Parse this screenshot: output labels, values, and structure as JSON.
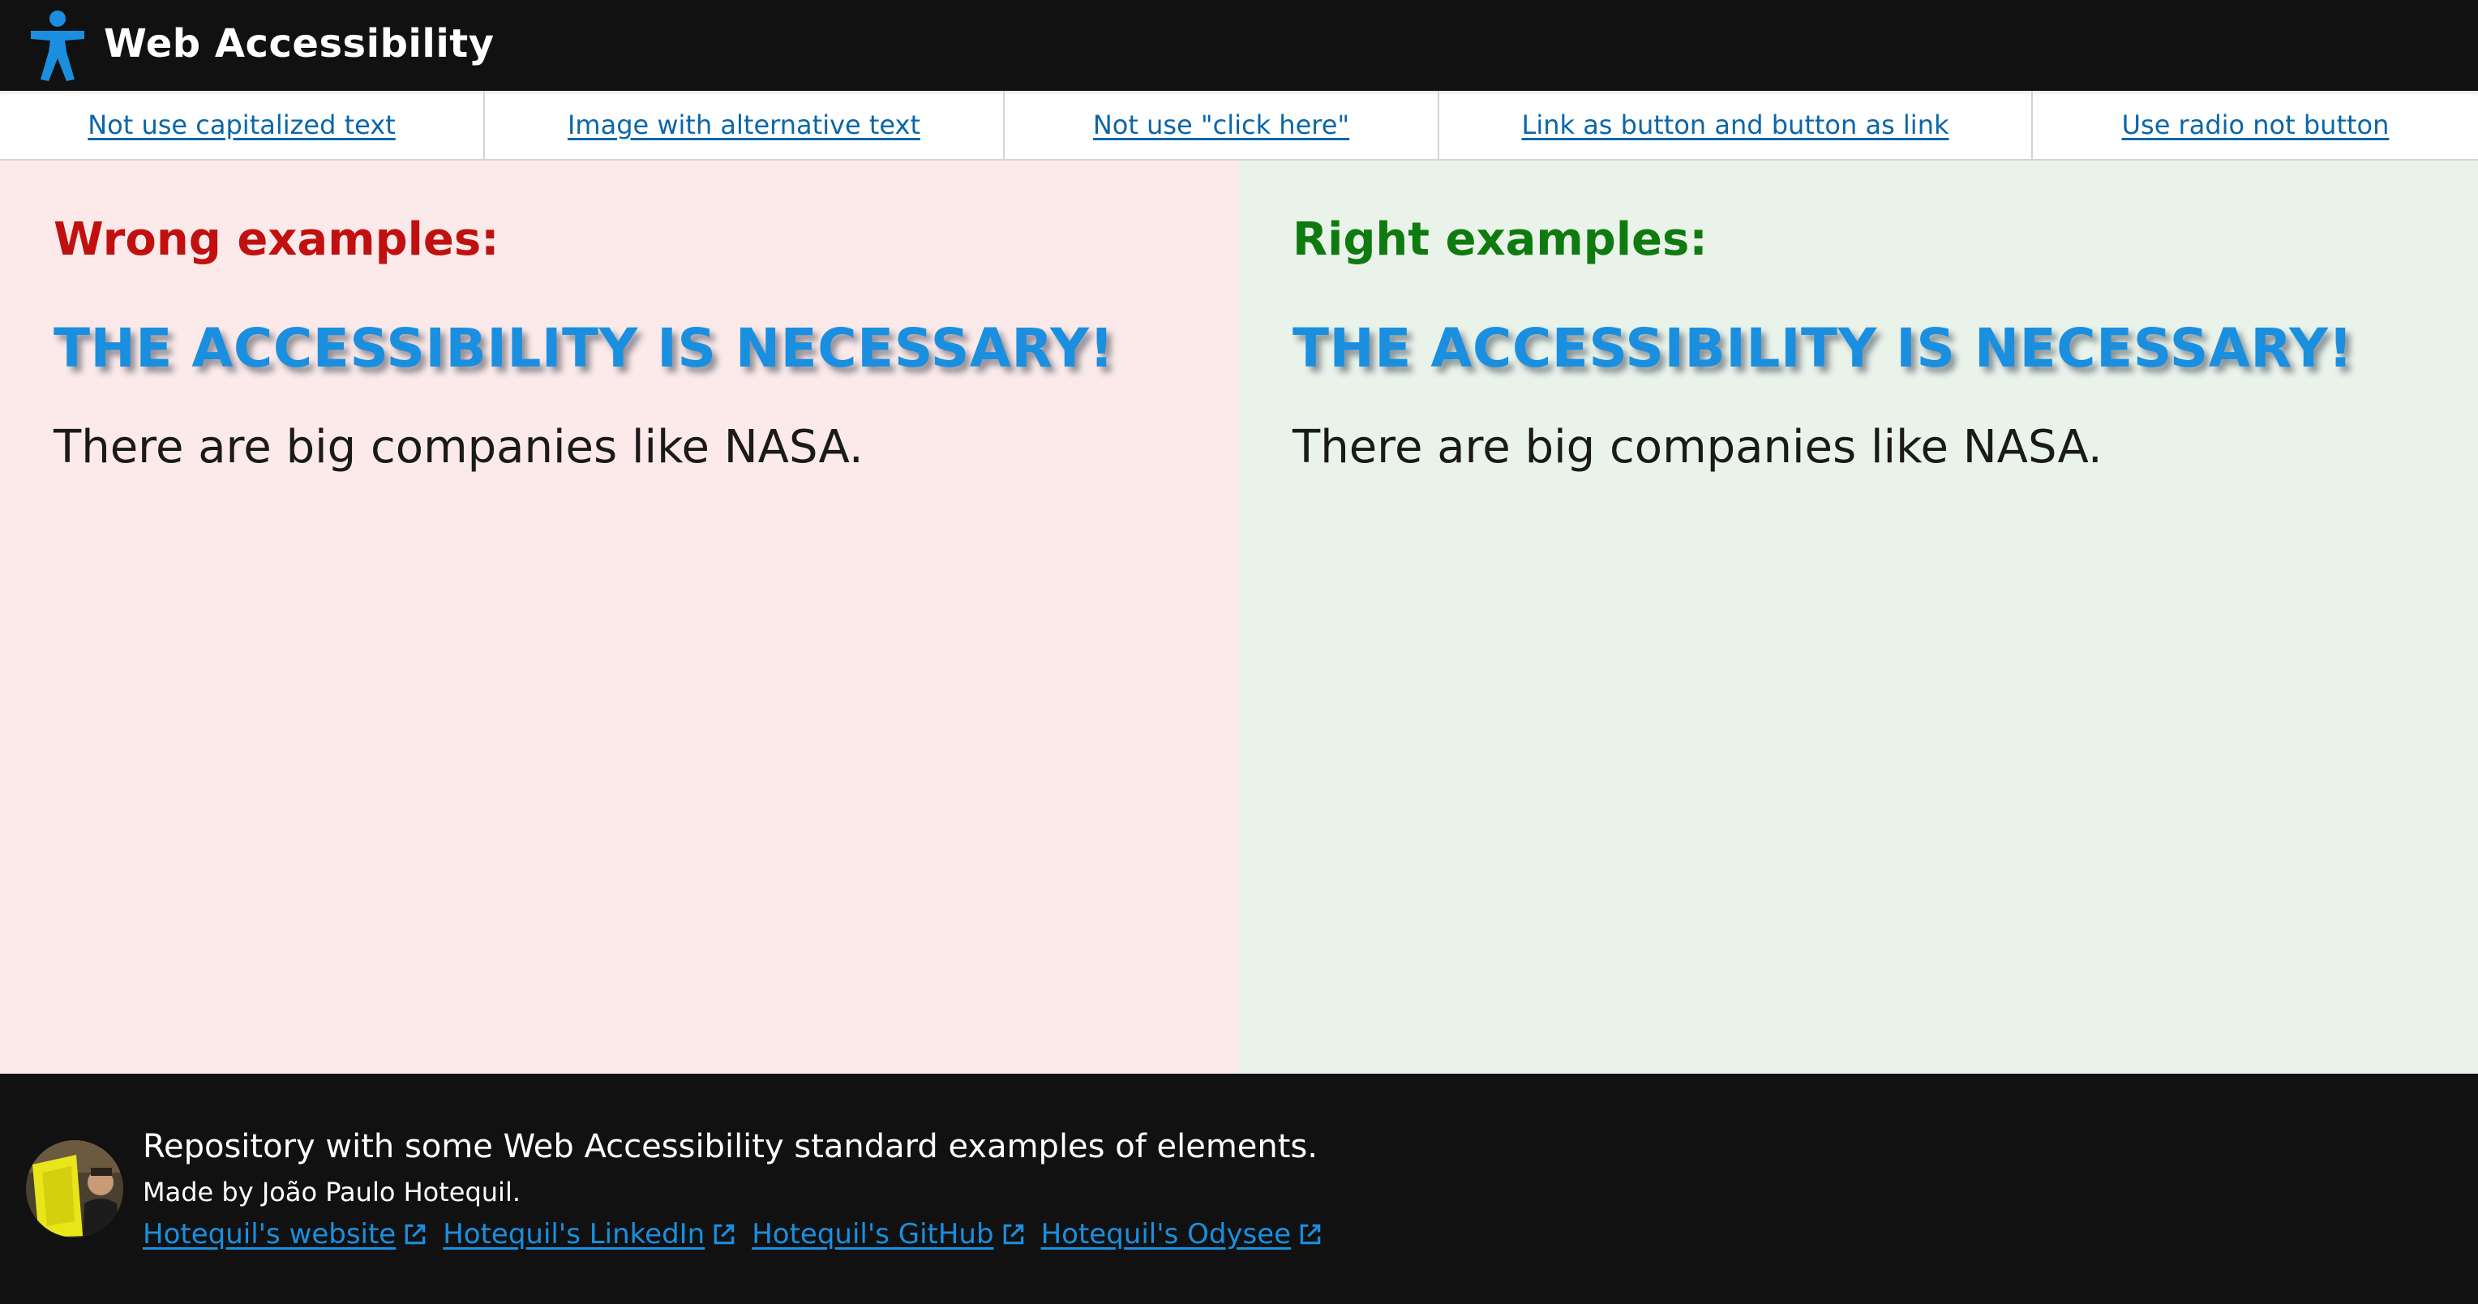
{
  "header": {
    "logo_icon": "accessibility-person-icon",
    "title": "Web Accessibility"
  },
  "nav": {
    "tabs": [
      {
        "label": "Not use capitalized text"
      },
      {
        "label": "Image with alternative text"
      },
      {
        "label": "Not use \"click here\""
      },
      {
        "label": "Link as button and button as link"
      },
      {
        "label": "Use radio not button"
      }
    ]
  },
  "wrong": {
    "heading": "Wrong examples:",
    "banner": "THE ACCESSIBILITY IS NECESSARY!",
    "text": "There are big companies like NASA."
  },
  "right": {
    "heading": "Right examples:",
    "banner": "THE ACCESSIBILITY IS NECESSARY!",
    "text": "There are big companies like NASA."
  },
  "footer": {
    "description": "Repository with some Web Accessibility standard examples of elements.",
    "author": "Made by João Paulo Hotequil.",
    "links": [
      {
        "label": "Hotequil's website",
        "icon": "external-link-icon"
      },
      {
        "label": "Hotequil's LinkedIn",
        "icon": "external-link-icon"
      },
      {
        "label": "Hotequil's GitHub",
        "icon": "external-link-icon"
      },
      {
        "label": "Hotequil's Odysee",
        "icon": "external-link-icon"
      }
    ]
  },
  "colors": {
    "header_bg": "#111111",
    "link": "#0b66a8",
    "accent_blue": "#1a8fe0",
    "wrong_heading": "#c01010",
    "right_heading": "#0f7a0f",
    "wrong_bg": "#fbeae9",
    "right_bg": "#e9f3ea"
  }
}
